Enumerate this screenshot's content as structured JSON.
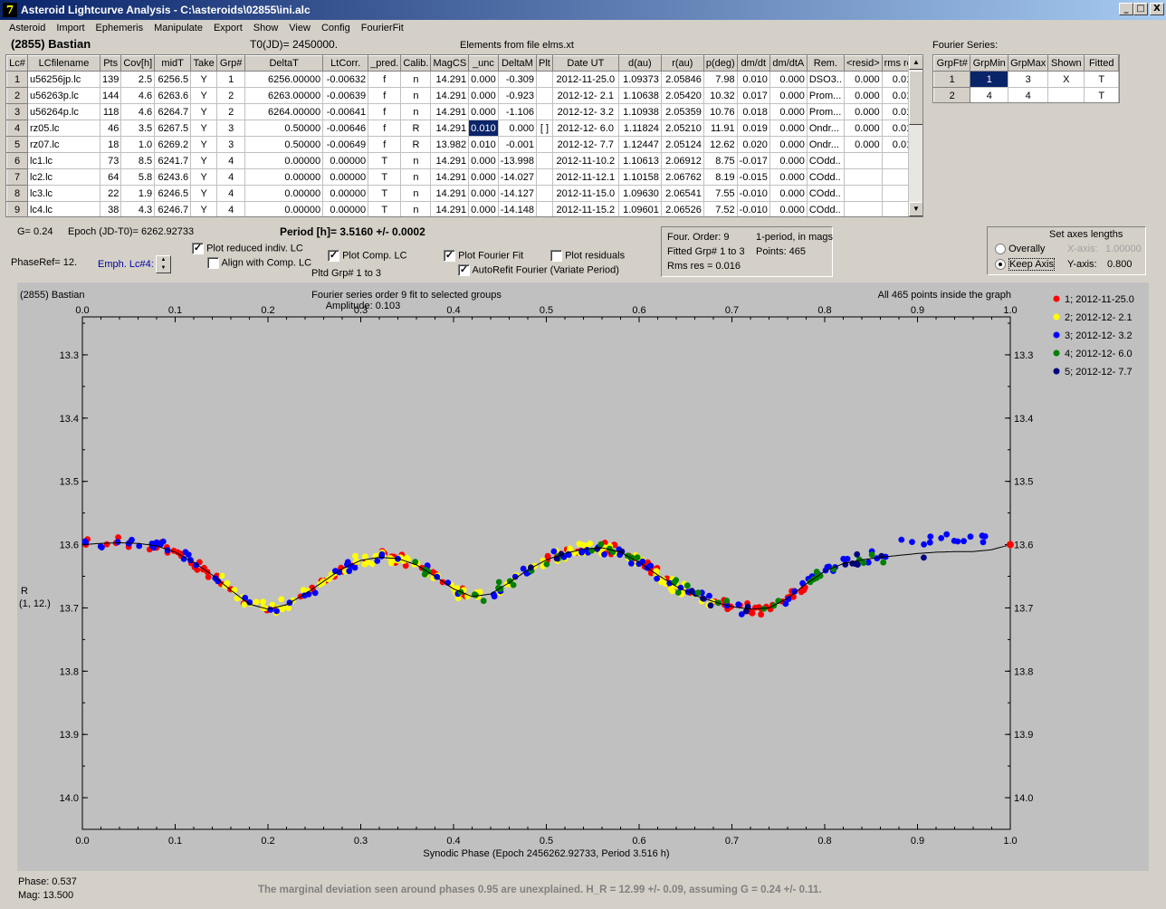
{
  "window": {
    "title": "Asteroid Lightcurve Analysis - C:\\asteroids\\02855\\ini.alc",
    "icon_glyph": "7",
    "btn_min": "_",
    "btn_max": "□",
    "btn_close": "X"
  },
  "menu": [
    "Asteroid",
    "Import",
    "Ephemeris",
    "Manipulate",
    "Export",
    "Show",
    "View",
    "Config",
    "FourierFit"
  ],
  "header": {
    "asteroid_name": "(2855) Bastian",
    "t0": "T0(JD)= 2450000.",
    "elements": "Elements from file elms.xt",
    "fourier_label": "Fourier Series:"
  },
  "lc_table": {
    "columns": [
      "Lc#",
      "LCfilename",
      "Pts",
      "Cov[h]",
      "midT",
      "Take",
      "Grp#",
      "DeltaT",
      "LtCorr.",
      "_pred.",
      "Calib.",
      "MagCS",
      "_unc",
      "DeltaM",
      "Plt",
      "Date UT",
      "d(au)",
      "r(au)",
      "p(deg)",
      "dm/dt",
      "dm/dtA",
      "Rem.",
      "<resid>",
      "rms res"
    ],
    "rows": [
      [
        "1",
        "u56256jp.lc",
        "139",
        "2.5",
        "6256.5",
        "Y",
        "1",
        "6256.00000",
        "-0.00632",
        "f",
        "n",
        "14.291",
        "0.000",
        "-0.309",
        "",
        "2012-11-25.0",
        "1.09373",
        "2.05846",
        "7.98",
        "0.010",
        "0.000",
        "DSO3..",
        "0.000",
        "0.015"
      ],
      [
        "2",
        "u56263p.lc",
        "144",
        "4.6",
        "6263.6",
        "Y",
        "2",
        "6263.00000",
        "-0.00639",
        "f",
        "n",
        "14.291",
        "0.000",
        "-0.923",
        "",
        "2012-12- 2.1",
        "1.10638",
        "2.05420",
        "10.32",
        "0.017",
        "0.000",
        "Prom...",
        "0.000",
        "0.017"
      ],
      [
        "3",
        "u56264p.lc",
        "118",
        "4.6",
        "6264.7",
        "Y",
        "2",
        "6264.00000",
        "-0.00641",
        "f",
        "n",
        "14.291",
        "0.000",
        "-1.106",
        "",
        "2012-12- 3.2",
        "1.10938",
        "2.05359",
        "10.76",
        "0.018",
        "0.000",
        "Prom...",
        "0.000",
        "0.017"
      ],
      [
        "4",
        "rz05.lc",
        "46",
        "3.5",
        "6267.5",
        "Y",
        "3",
        "0.50000",
        "-0.00646",
        "f",
        "R",
        "14.291",
        "0.010",
        "0.000",
        "[ ]",
        "2012-12- 6.0",
        "1.11824",
        "2.05210",
        "11.91",
        "0.019",
        "0.000",
        "Ondr...",
        "0.000",
        "0.012"
      ],
      [
        "5",
        "rz07.lc",
        "18",
        "1.0",
        "6269.2",
        "Y",
        "3",
        "0.50000",
        "-0.00649",
        "f",
        "R",
        "13.982",
        "0.010",
        "-0.001",
        "",
        "2012-12- 7.7",
        "1.12447",
        "2.05124",
        "12.62",
        "0.020",
        "0.000",
        "Ondr...",
        "0.000",
        "0.012"
      ],
      [
        "6",
        "lc1.lc",
        "73",
        "8.5",
        "6241.7",
        "Y",
        "4",
        "0.00000",
        "0.00000",
        "T",
        "n",
        "14.291",
        "0.000",
        "-13.998",
        "",
        "2012-11-10.2",
        "1.10613",
        "2.06912",
        "8.75",
        "-0.017",
        "0.000",
        "COdd..",
        "",
        ""
      ],
      [
        "7",
        "lc2.lc",
        "64",
        "5.8",
        "6243.6",
        "Y",
        "4",
        "0.00000",
        "0.00000",
        "T",
        "n",
        "14.291",
        "0.000",
        "-14.027",
        "",
        "2012-11-12.1",
        "1.10158",
        "2.06762",
        "8.19",
        "-0.015",
        "0.000",
        "COdd..",
        "",
        ""
      ],
      [
        "8",
        "lc3.lc",
        "22",
        "1.9",
        "6246.5",
        "Y",
        "4",
        "0.00000",
        "0.00000",
        "T",
        "n",
        "14.291",
        "0.000",
        "-14.127",
        "",
        "2012-11-15.0",
        "1.09630",
        "2.06541",
        "7.55",
        "-0.010",
        "0.000",
        "COdd..",
        "",
        ""
      ],
      [
        "9",
        "lc4.lc",
        "38",
        "4.3",
        "6246.7",
        "Y",
        "4",
        "0.00000",
        "0.00000",
        "T",
        "n",
        "14.291",
        "0.000",
        "-14.148",
        "",
        "2012-11-15.2",
        "1.09601",
        "2.06526",
        "7.52",
        "-0.010",
        "0.000",
        "COdd..",
        "",
        ""
      ]
    ]
  },
  "fourier_table": {
    "columns": [
      "GrpFt#",
      "GrpMin",
      "GrpMax",
      "Shown",
      "Fitted"
    ],
    "rows": [
      [
        "1",
        "1",
        "3",
        "X",
        "T"
      ],
      [
        "2",
        "4",
        "4",
        "",
        "T"
      ]
    ]
  },
  "controls": {
    "g_value": "G= 0.24",
    "epoch": "Epoch (JD-T0)= 6262.92733",
    "period": "Period [h]= 3.5160 +/- 0.0002",
    "phaseref": "PhaseRef= 12.",
    "emph": "Emph. Lc#4:",
    "plot_reduced": "Plot reduced indiv. LC",
    "align_comp": "Align with Comp. LC",
    "plot_comp": "Plot Comp. LC",
    "pltd_grp": "Pltd Grp#  1   to    3",
    "plot_fourier": "Plot Fourier Fit",
    "autorefit": "AutoRefit Fourier (Variate Period)",
    "plot_residuals": "Plot residuals",
    "check_mark": "✓"
  },
  "info_box": {
    "four_order": "Four. Order:  9",
    "one_period": "1-period, in mags",
    "fitted": "Fitted Grp# 1 to 3",
    "points": "Points: 465",
    "rms": "Rms res     = 0.016"
  },
  "axes_box": {
    "title": "Set axes lengths",
    "overally": "Overally",
    "keep_axis": "Keep Axis",
    "xaxis_label": "X-axis:",
    "xaxis_val": "1.00000",
    "yaxis_label": "Y-axis:",
    "yaxis_val": "0.800"
  },
  "status": {
    "phase": "Phase:  0.537",
    "mag": "Mag:    13.500",
    "note": "The marginal deviation seen around phases 0.95 are unexplained.  H_R = 12.99 +/- 0.09, assuming G = 0.24 +/- 0.11."
  },
  "colors": {
    "series": [
      "#ff0000",
      "#ffff00",
      "#0000ff",
      "#008000",
      "#000080"
    ],
    "plot_bg": "#c0c0c0"
  },
  "chart_data": {
    "type": "scatter",
    "title_left": "(2855) Bastian",
    "title_center": "Fourier series order 9 fit to selected groups",
    "amplitude": "Amplitude: 0.103",
    "title_right": "All 465 points inside the graph",
    "xlabel": "Synodic Phase (Epoch 2456262.92733, Period 3.516 h)",
    "ylabel": "R",
    "ylabel2": "(1, 12.)",
    "xlim": [
      0.0,
      1.0
    ],
    "ylim": [
      13.24,
      14.05
    ],
    "y_inverted": true,
    "x_ticks": [
      "0.0",
      "0.1",
      "0.2",
      "0.3",
      "0.4",
      "0.5",
      "0.6",
      "0.7",
      "0.8",
      "0.9",
      "1.0"
    ],
    "y_ticks": [
      "13.3",
      "13.4",
      "13.5",
      "13.6",
      "13.7",
      "13.8",
      "13.9",
      "14.0"
    ],
    "series": [
      {
        "name": "1; 2012-11-25.0"
      },
      {
        "name": "2; 2012-12- 2.1"
      },
      {
        "name": "3; 2012-12- 3.2"
      },
      {
        "name": "4; 2012-12- 6.0"
      },
      {
        "name": "5; 2012-12- 7.7"
      }
    ],
    "fit_curve": [
      [
        0.0,
        13.6
      ],
      [
        0.02,
        13.598
      ],
      [
        0.04,
        13.597
      ],
      [
        0.06,
        13.598
      ],
      [
        0.08,
        13.602
      ],
      [
        0.1,
        13.612
      ],
      [
        0.12,
        13.628
      ],
      [
        0.14,
        13.648
      ],
      [
        0.16,
        13.672
      ],
      [
        0.18,
        13.694
      ],
      [
        0.2,
        13.702
      ],
      [
        0.22,
        13.695
      ],
      [
        0.24,
        13.678
      ],
      [
        0.26,
        13.658
      ],
      [
        0.28,
        13.638
      ],
      [
        0.3,
        13.625
      ],
      [
        0.32,
        13.62
      ],
      [
        0.34,
        13.622
      ],
      [
        0.36,
        13.632
      ],
      [
        0.38,
        13.65
      ],
      [
        0.4,
        13.67
      ],
      [
        0.42,
        13.682
      ],
      [
        0.44,
        13.678
      ],
      [
        0.46,
        13.66
      ],
      [
        0.48,
        13.64
      ],
      [
        0.5,
        13.624
      ],
      [
        0.52,
        13.614
      ],
      [
        0.54,
        13.607
      ],
      [
        0.56,
        13.605
      ],
      [
        0.58,
        13.612
      ],
      [
        0.6,
        13.628
      ],
      [
        0.62,
        13.648
      ],
      [
        0.64,
        13.666
      ],
      [
        0.66,
        13.68
      ],
      [
        0.68,
        13.69
      ],
      [
        0.7,
        13.698
      ],
      [
        0.72,
        13.702
      ],
      [
        0.74,
        13.7
      ],
      [
        0.76,
        13.685
      ],
      [
        0.78,
        13.662
      ],
      [
        0.8,
        13.642
      ],
      [
        0.82,
        13.63
      ],
      [
        0.84,
        13.624
      ],
      [
        0.86,
        13.62
      ],
      [
        0.88,
        13.617
      ],
      [
        0.9,
        13.614
      ],
      [
        0.92,
        13.612
      ],
      [
        0.94,
        13.611
      ],
      [
        0.96,
        13.611
      ],
      [
        0.98,
        13.608
      ],
      [
        1.0,
        13.6
      ]
    ],
    "points_per_series": [
      139,
      144,
      118,
      46,
      18
    ],
    "point_offsets_amplitude": 0.012
  }
}
